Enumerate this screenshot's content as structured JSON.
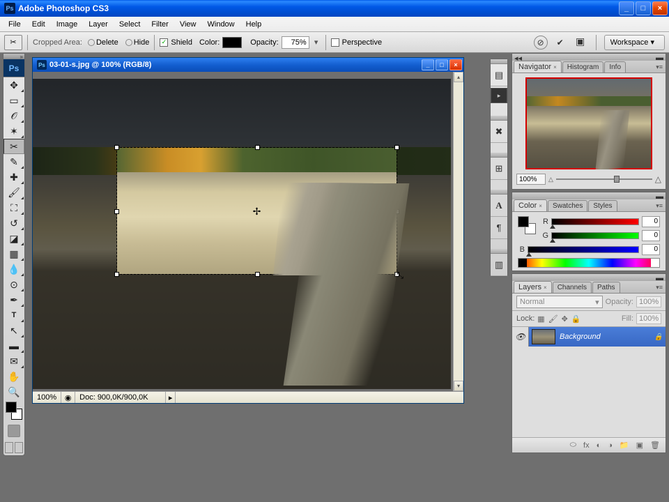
{
  "app": {
    "title": "Adobe Photoshop CS3",
    "logo": "Ps"
  },
  "menu": [
    "File",
    "Edit",
    "Image",
    "Layer",
    "Select",
    "Filter",
    "View",
    "Window",
    "Help"
  ],
  "options": {
    "tool": "crop",
    "cropped_area_label": "Cropped Area:",
    "delete": "Delete",
    "hide": "Hide",
    "shield_checked": "✓",
    "shield_label": "Shield",
    "color_label": "Color:",
    "opacity_label": "Opacity:",
    "opacity_value": "75%",
    "perspective_label": "Perspective",
    "workspace": "Workspace ▾"
  },
  "doc": {
    "title": "03-01-s.jpg @ 100% (RGB/8)",
    "zoom": "100%",
    "status": "Doc: 900,0K/900,0K"
  },
  "navigator": {
    "tabs": [
      "Navigator",
      "Histogram",
      "Info"
    ],
    "zoom": "100%"
  },
  "color_panel": {
    "tabs": [
      "Color",
      "Swatches",
      "Styles"
    ],
    "r_label": "R",
    "g_label": "G",
    "b_label": "B",
    "r": "0",
    "g": "0",
    "b": "0"
  },
  "layers": {
    "tabs": [
      "Layers",
      "Channels",
      "Paths"
    ],
    "blend": "Normal",
    "opacity_label": "Opacity:",
    "opacity": "100%",
    "lock_label": "Lock:",
    "fill_label": "Fill:",
    "fill": "100%",
    "layer_name": "Background"
  }
}
